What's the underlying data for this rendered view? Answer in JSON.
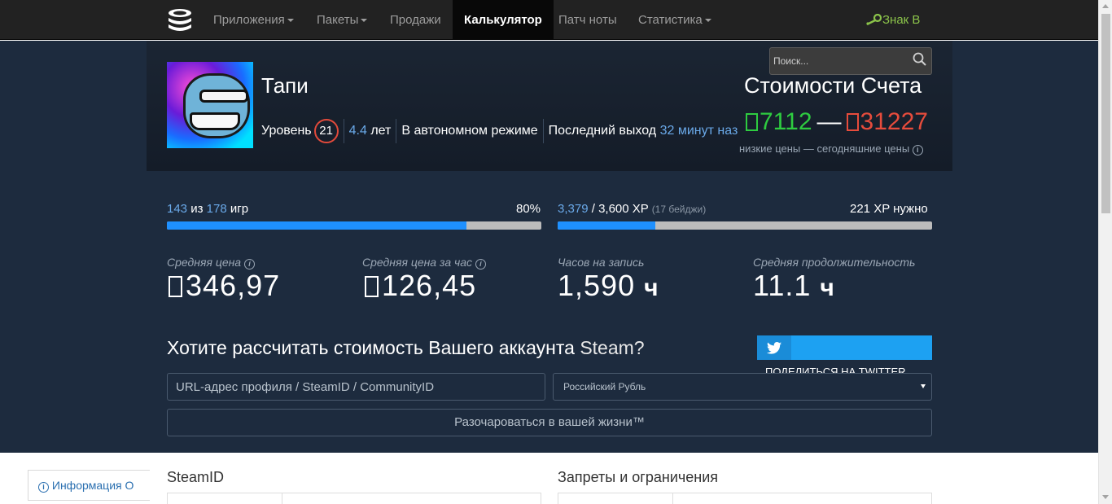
{
  "navbar": {
    "items": [
      {
        "label": "Приложения",
        "has_caret": true
      },
      {
        "label": "Пакеты",
        "has_caret": true
      },
      {
        "label": "Продажи",
        "has_caret": false
      },
      {
        "label": "Калькулятор",
        "active": true
      },
      {
        "label": "Патч ноты",
        "has_caret": false
      },
      {
        "label": "Статистика",
        "has_caret": true
      }
    ],
    "badge_label": "Знак В",
    "badge_icon": "steam-key-icon"
  },
  "search": {
    "placeholder": "Поиск..."
  },
  "profile": {
    "name": "Тапи",
    "level_label": "Уровень",
    "level": "21",
    "years_value": "4.4",
    "years_label": "лет",
    "status": "В автономном режиме",
    "last_online_label": "Последний выход",
    "last_online_value": "32 минут наз"
  },
  "account_value": {
    "title": "Стоимости Счета",
    "low": "7112",
    "dash": "—",
    "high": "31227",
    "note": "низкие цены — сегодняшние цены"
  },
  "progress": {
    "games": {
      "owned": "143",
      "of": "из",
      "total": "178",
      "unit": "игр",
      "percent_label": "80%",
      "fraction": 0.8
    },
    "xp": {
      "current": "3,379",
      "sep": "/",
      "target": "3,600 XP",
      "badges": "(17 бейджи)",
      "needed": "221 XP нужно",
      "fraction": 0.26
    }
  },
  "stats": [
    {
      "label": "Средняя цена",
      "value": "346,97",
      "unit": "",
      "currency": true,
      "info": true
    },
    {
      "label": "Средняя цена за час",
      "value": "126,45",
      "unit": "",
      "currency": true,
      "info": true
    },
    {
      "label": "Часов на запись",
      "value": "1,590",
      "unit": "ч",
      "currency": false,
      "info": false
    },
    {
      "label": "Средняя продолжительность",
      "value": "11.1",
      "unit": "ч",
      "currency": false,
      "info": false
    }
  ],
  "calculator": {
    "title": "Хотите рассчитать стоимость Вашего аккаунта",
    "title_light": "Steam?",
    "url_placeholder": "URL-адрес профиля / SteamID / CommunityID",
    "currency_selected": "Российский Рубль",
    "submit_label": "Разочароваться в вашей жизни™",
    "twitter_label": "ПОДЕЛИТЬСЯ НА TWITTER",
    "twitter_icon": "twitter-icon"
  },
  "bottom": {
    "info_tab": "Информация О",
    "left_title": "SteamID",
    "right_title": "Запреты и ограничения"
  },
  "colors": {
    "nav_bg": "#222222",
    "hero_bg": "#1d2b3e",
    "accent_blue": "#6aa9e9",
    "green": "#2ecc40",
    "red": "#e74c3c",
    "progress_fill": "#1e90ff"
  }
}
